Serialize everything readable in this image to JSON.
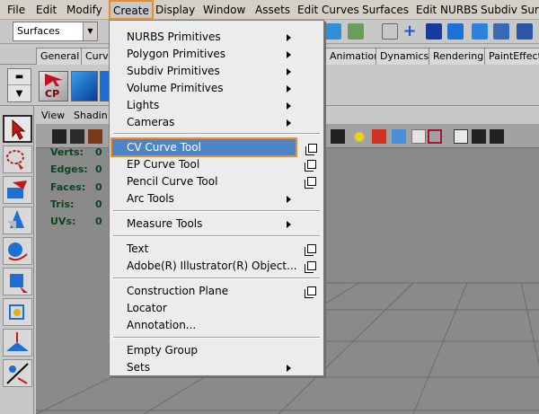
{
  "menubar": {
    "items": [
      "File",
      "Edit",
      "Modify",
      "Create",
      "Display",
      "Window",
      "Assets",
      "Edit Curves",
      "Surfaces",
      "Edit NURBS",
      "Subdiv Surfa"
    ]
  },
  "toolbar": {
    "menuset_value": "Surfaces"
  },
  "shelf_tabs": [
    "General",
    "Curv",
    "Animation",
    "Dynamics",
    "Rendering",
    "PaintEffects"
  ],
  "shelf": {
    "cp_label": "CP"
  },
  "viewport": {
    "menu": [
      "View",
      "Shadin"
    ],
    "hud": {
      "labels": [
        "Verts:",
        "Edges:",
        "Faces:",
        "Tris:",
        "UVs:"
      ],
      "values": [
        "0",
        "0",
        "0",
        "0",
        "0"
      ]
    }
  },
  "create_menu": {
    "groups": [
      [
        {
          "label": "NURBS Primitives",
          "submenu": true
        },
        {
          "label": "Polygon Primitives",
          "submenu": true
        },
        {
          "label": "Subdiv Primitives",
          "submenu": true
        },
        {
          "label": "Volume Primitives",
          "submenu": true
        },
        {
          "label": "Lights",
          "submenu": true
        },
        {
          "label": "Cameras",
          "submenu": true
        }
      ],
      [
        {
          "label": "CV Curve Tool",
          "option_box": true,
          "highlighted": true
        },
        {
          "label": "EP Curve Tool",
          "option_box": true
        },
        {
          "label": "Pencil Curve Tool",
          "option_box": true
        },
        {
          "label": "Arc Tools",
          "submenu": true
        }
      ],
      [
        {
          "label": "Measure Tools",
          "submenu": true
        }
      ],
      [
        {
          "label": "Text",
          "option_box": true
        },
        {
          "label": "Adobe(R) Illustrator(R) Object...",
          "option_box": true
        }
      ],
      [
        {
          "label": "Construction Plane",
          "option_box": true
        },
        {
          "label": "Locator"
        },
        {
          "label": "Annotation..."
        }
      ],
      [
        {
          "label": "Empty Group"
        },
        {
          "label": "Sets",
          "submenu": true
        }
      ]
    ]
  },
  "colors": {
    "highlight_outline": "#f08a24",
    "selected_item_bg": "#4f84c4",
    "viewport_bg": "#8a8a8a",
    "hud_text": "#0c4420"
  }
}
